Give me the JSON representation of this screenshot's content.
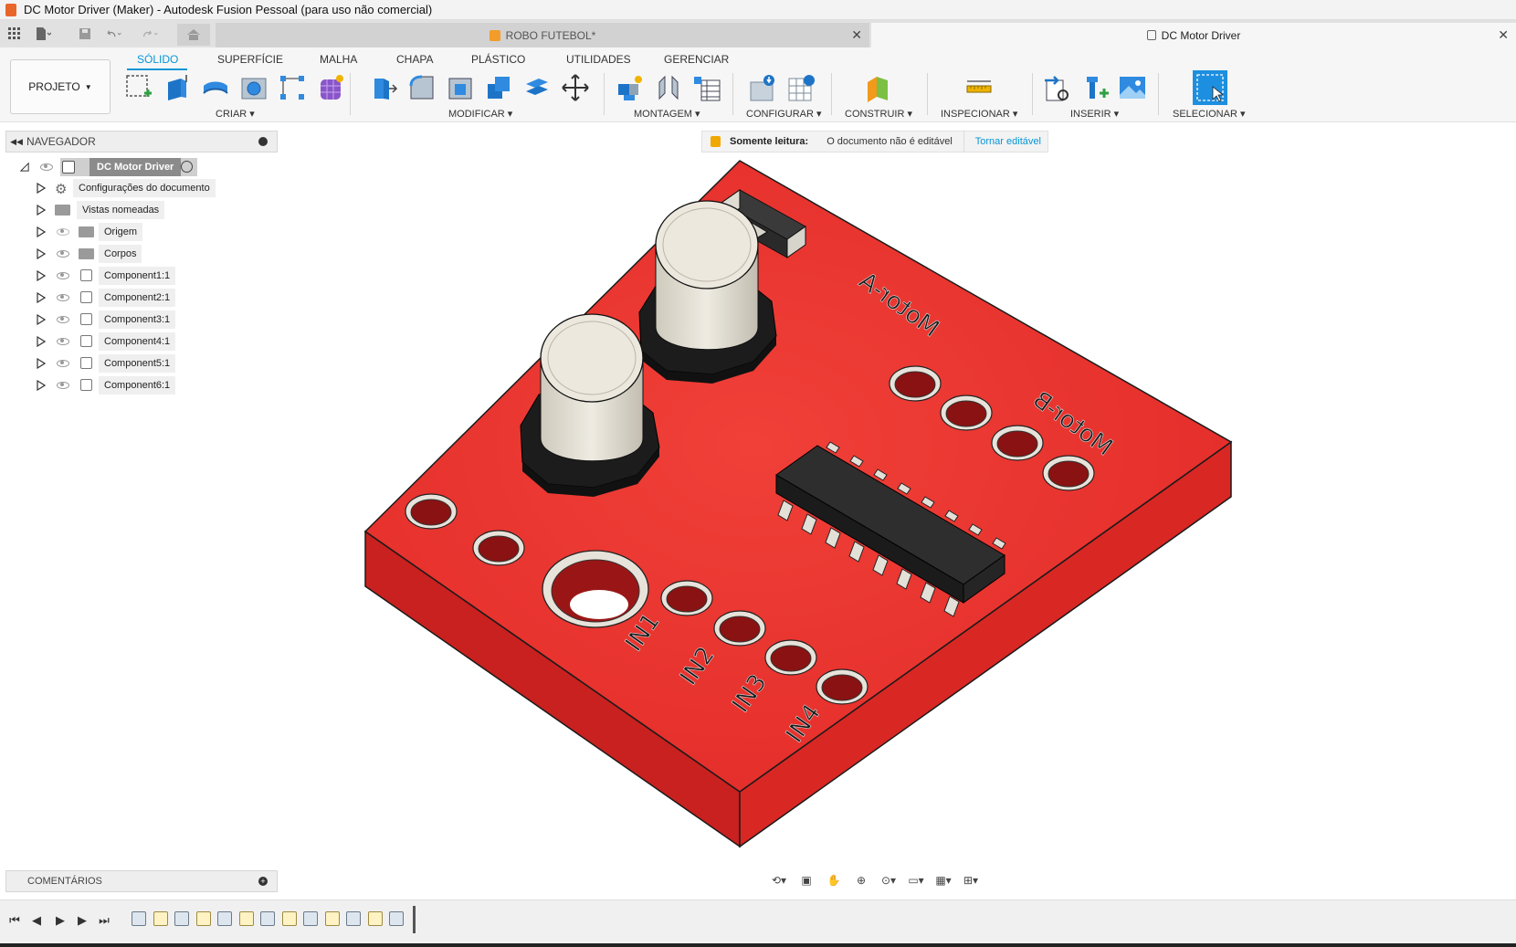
{
  "window": {
    "title": "DC Motor Driver (Maker) - Autodesk Fusion Pessoal (para uso não comercial)"
  },
  "document_tabs": [
    {
      "label": "ROBO FUTEBOL*",
      "active": false
    },
    {
      "label": "DC Motor Driver",
      "active": true
    }
  ],
  "toolbar": {
    "project_label": "PROJETO",
    "workspace_tabs": [
      "SÓLIDO",
      "SUPERFÍCIE",
      "MALHA",
      "CHAPA",
      "PLÁSTICO",
      "UTILIDADES",
      "GERENCIAR"
    ],
    "groups": [
      "CRIAR",
      "MODIFICAR",
      "MONTAGEM",
      "CONFIGURAR",
      "CONSTRUIR",
      "INSPECIONAR",
      "INSERIR",
      "SELECIONAR"
    ]
  },
  "browser": {
    "title": "NAVEGADOR",
    "root": "DC Motor Driver",
    "items": [
      {
        "label": "Configurações do documento",
        "icon": "gear-icon"
      },
      {
        "label": "Vistas nomeadas",
        "icon": "folder-icon"
      },
      {
        "label": "Origem",
        "icon": "folder-icon"
      },
      {
        "label": "Corpos",
        "icon": "folder-icon"
      },
      {
        "label": "Component1:1",
        "icon": "component-icon"
      },
      {
        "label": "Component2:1",
        "icon": "component-icon"
      },
      {
        "label": "Component3:1",
        "icon": "component-icon"
      },
      {
        "label": "Component4:1",
        "icon": "component-icon"
      },
      {
        "label": "Component5:1",
        "icon": "component-icon"
      },
      {
        "label": "Component6:1",
        "icon": "component-icon"
      }
    ]
  },
  "readonly_banner": {
    "title": "Somente leitura:",
    "message": "O documento não é editável",
    "action": "Tornar editável"
  },
  "model": {
    "silkscreen": [
      "Motor-A",
      "Motor-B",
      "IN1",
      "IN2",
      "IN3",
      "IN4"
    ],
    "board_color": "#e8302e"
  },
  "comments": {
    "title": "COMENTÁRIOS"
  },
  "colors": {
    "accent": "#0696d7",
    "board": "#e8302e",
    "board_side": "#c8211f"
  }
}
